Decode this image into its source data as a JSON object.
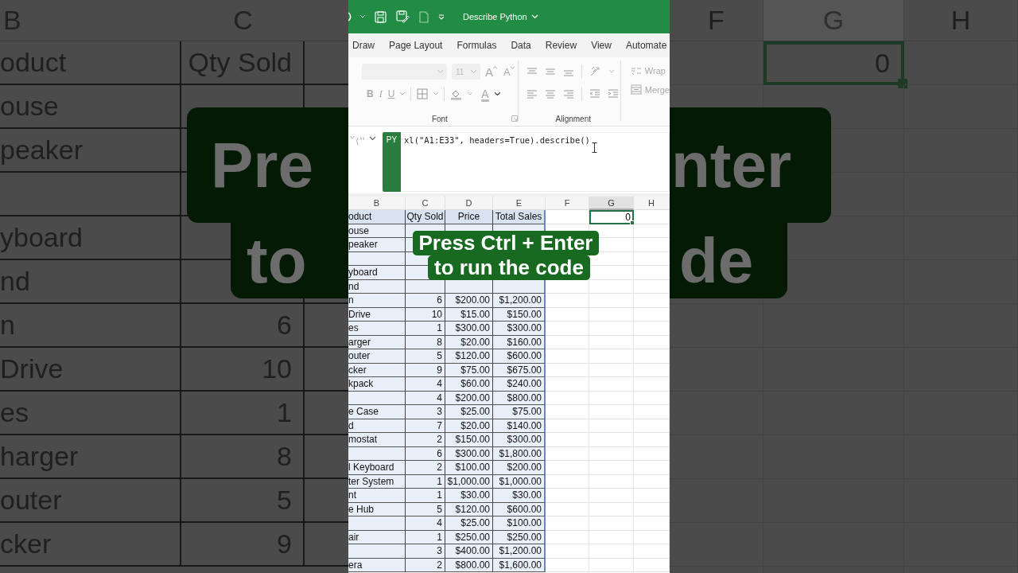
{
  "backdrop_left": {
    "column_headers": [
      "B",
      "C"
    ],
    "rows": [
      {
        "product": "oduct",
        "qty": "Qty Sold"
      },
      {
        "product": "ouse"
      },
      {
        "product": "peaker"
      },
      {},
      {
        "product": "yboard"
      },
      {
        "product": "nd"
      },
      {
        "product": "n",
        "qty": "6"
      },
      {
        "product": "Drive",
        "qty": "10"
      },
      {
        "product": "es",
        "qty": "1"
      },
      {
        "product": "harger",
        "qty": "8"
      },
      {
        "product": "outer",
        "qty": "5"
      },
      {
        "product": "cker",
        "qty": "9"
      }
    ],
    "caption_fragments": [
      "Pre",
      "to"
    ]
  },
  "title_bar": {
    "title": "Describe Python"
  },
  "ribbon_tabs": [
    "Draw",
    "Page Layout",
    "Formulas",
    "Data",
    "Review",
    "View",
    "Automate"
  ],
  "ribbon": {
    "font_size": "11",
    "grow_font": "A",
    "shrink_font": "A",
    "bold": "B",
    "italic": "I",
    "underline": "U",
    "font_color": "A",
    "font_group": "Font",
    "alignment_group": "Alignment",
    "wrap_text": "Wrap",
    "merge": "Merge"
  },
  "formula_bar": {
    "badge": "PY",
    "code": "xl(\"A1:E33\", headers=True).describe()"
  },
  "sheet": {
    "columns": [
      {
        "label": "B",
        "selected": false
      },
      {
        "label": "C",
        "selected": false
      },
      {
        "label": "D",
        "selected": false
      },
      {
        "label": "E",
        "selected": false
      },
      {
        "label": "F",
        "selected": false
      },
      {
        "label": "G",
        "selected": true
      },
      {
        "label": "H",
        "selected": false
      }
    ],
    "header_row": {
      "product": "oduct",
      "qty": "Qty Sold",
      "price": "Price",
      "total": "Total Sales"
    },
    "active_cell": {
      "value": "0"
    },
    "rows": [
      {
        "product": "ouse"
      },
      {
        "product": "peaker"
      },
      {},
      {
        "product": "yboard"
      },
      {
        "product": "nd"
      },
      {
        "product": "n",
        "qty": "6",
        "price": "$200.00",
        "total": "$1,200.00"
      },
      {
        "product": "Drive",
        "qty": "10",
        "price": "$15.00",
        "total": "$150.00"
      },
      {
        "product": "es",
        "qty": "1",
        "price": "$300.00",
        "total": "$300.00"
      },
      {
        "product": "arger",
        "qty": "8",
        "price": "$20.00",
        "total": "$160.00"
      },
      {
        "product": "outer",
        "qty": "5",
        "price": "$120.00",
        "total": "$600.00"
      },
      {
        "product": "cker",
        "qty": "9",
        "price": "$75.00",
        "total": "$675.00"
      },
      {
        "product": "kpack",
        "qty": "4",
        "price": "$60.00",
        "total": "$240.00"
      },
      {
        "qty": "4",
        "price": "$200.00",
        "total": "$800.00"
      },
      {
        "product": "e Case",
        "qty": "3",
        "price": "$25.00",
        "total": "$75.00"
      },
      {
        "product": "d",
        "qty": "7",
        "price": "$20.00",
        "total": "$140.00"
      },
      {
        "product": "mostat",
        "qty": "2",
        "price": "$150.00",
        "total": "$300.00"
      },
      {
        "qty": "6",
        "price": "$300.00",
        "total": "$1,800.00"
      },
      {
        "product": "l Keyboard",
        "qty": "2",
        "price": "$100.00",
        "total": "$200.00"
      },
      {
        "product": "ter System",
        "qty": "1",
        "price": "$1,000.00",
        "total": "$1,000.00"
      },
      {
        "product": "nt",
        "qty": "1",
        "price": "$30.00",
        "total": "$30.00"
      },
      {
        "product": "e Hub",
        "qty": "5",
        "price": "$120.00",
        "total": "$600.00"
      },
      {
        "qty": "4",
        "price": "$25.00",
        "total": "$100.00"
      },
      {
        "product": "air",
        "qty": "1",
        "price": "$250.00",
        "total": "$250.00"
      },
      {
        "qty": "3",
        "price": "$400.00",
        "total": "$1,200.00"
      },
      {
        "product": "era",
        "qty": "2",
        "price": "$800.00",
        "total": "$1,600.00"
      }
    ]
  },
  "caption_lines": [
    "Press Ctrl + Enter",
    "to run the code"
  ],
  "backdrop_right": {
    "columns": [
      {
        "label": "F",
        "selected": false
      },
      {
        "label": "G",
        "selected": true
      },
      {
        "label": "H",
        "selected": false
      }
    ],
    "active_cell": "0",
    "caption_fragments": [
      "nter",
      "de"
    ]
  }
}
